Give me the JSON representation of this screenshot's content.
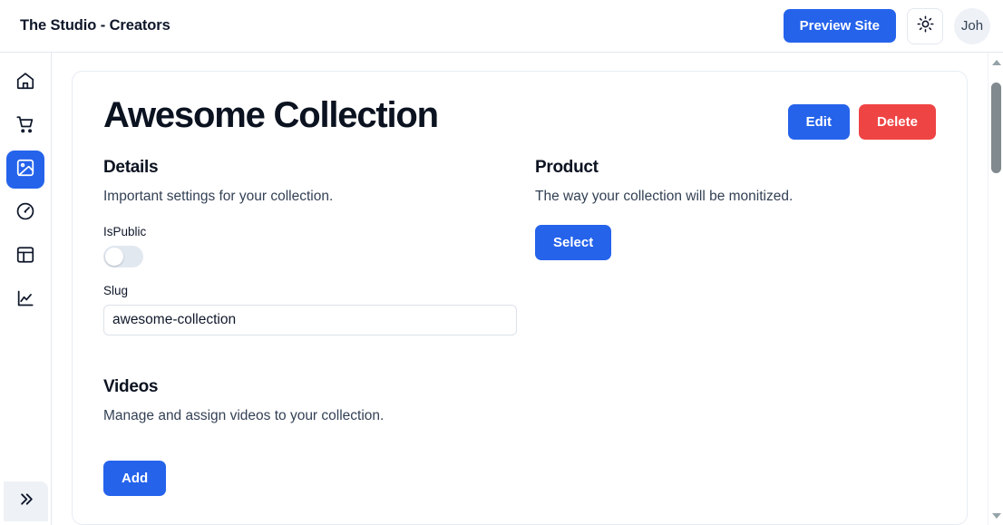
{
  "header": {
    "title": "The Studio - Creators",
    "preview_button": "Preview Site",
    "theme_icon": "sun-icon",
    "avatar_text": "Joh"
  },
  "sidebar": {
    "items": [
      {
        "icon": "home-icon",
        "active": false
      },
      {
        "icon": "shopping-cart-icon",
        "active": false
      },
      {
        "icon": "image-icon",
        "active": true
      },
      {
        "icon": "gauge-icon",
        "active": false
      },
      {
        "icon": "layout-dashboard-icon",
        "active": false
      },
      {
        "icon": "line-chart-icon",
        "active": false
      }
    ],
    "expand_icon": "double-chevron-right-icon"
  },
  "main": {
    "page_title": "Awesome Collection",
    "edit_button": "Edit",
    "delete_button": "Delete",
    "details": {
      "title": "Details",
      "description": "Important settings for your collection.",
      "is_public_label": "IsPublic",
      "is_public_value": false,
      "slug_label": "Slug",
      "slug_value": "awesome-collection",
      "slug_placeholder": "awesome-collection"
    },
    "product": {
      "title": "Product",
      "description": "The way your collection will be monitized.",
      "select_button": "Select"
    },
    "videos": {
      "title": "Videos",
      "description": "Manage and assign videos to your collection.",
      "add_button": "Add"
    }
  },
  "colors": {
    "accent_blue": "#2563eb",
    "danger_red": "#ef4444",
    "border": "#e2e8f0",
    "text": "#0f172a"
  }
}
